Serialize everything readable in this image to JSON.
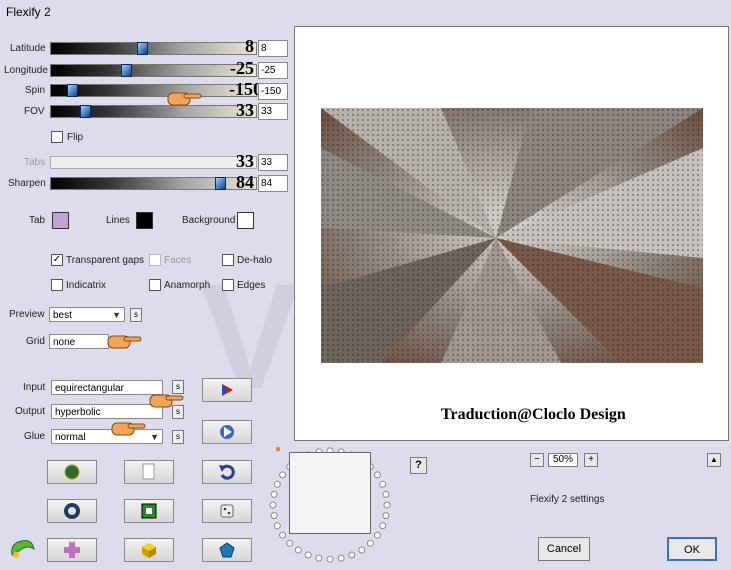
{
  "window": {
    "title": "Flexify 2"
  },
  "sliders": [
    {
      "label": "Latitude",
      "value": "8",
      "field": "8",
      "pos": 0.44,
      "disabled": false
    },
    {
      "label": "Longitude",
      "value": "-25",
      "field": "-25",
      "pos": 0.36,
      "disabled": false
    },
    {
      "label": "Spin",
      "value": "-150",
      "field": "-150",
      "pos": 0.08,
      "disabled": false
    },
    {
      "label": "FOV",
      "value": "33",
      "field": "33",
      "pos": 0.15,
      "disabled": false
    },
    {
      "label": "Tabs",
      "value": "33",
      "field": "33",
      "pos": 0.15,
      "disabled": true
    },
    {
      "label": "Sharpen",
      "value": "84",
      "field": "84",
      "pos": 0.84,
      "disabled": false
    }
  ],
  "flip": {
    "label": "Flip",
    "checked": false
  },
  "colors": {
    "tab_label": "Tab",
    "tab_color": "#c8a0d8",
    "lines_label": "Lines",
    "lines_color": "#000000",
    "background_label": "Background",
    "background_color": "#ffffff"
  },
  "options": {
    "transparent_gaps": "Transparent gaps",
    "faces": "Faces",
    "de_halo": "De-halo",
    "indicatrix": "Indicatrix",
    "anamorph": "Anamorph",
    "edges": "Edges"
  },
  "preview_select": {
    "label": "Preview",
    "value": "best"
  },
  "grid_select": {
    "label": "Grid",
    "value": "none"
  },
  "input_select": {
    "label": "Input",
    "value": "equirectangular"
  },
  "output_select": {
    "label": "Output",
    "value": "hyperbolic"
  },
  "glue_select": {
    "label": "Glue",
    "value": "normal"
  },
  "s_label": "s",
  "preview_caption": "Traduction@Cloclo Design",
  "watermark": "VERS",
  "help_label": "?",
  "zoom": {
    "minus": "−",
    "value": "50%",
    "plus": "+",
    "up": "▲"
  },
  "settings_label": "Flexify 2 settings",
  "cancel_label": "Cancel",
  "ok_label": "OK"
}
